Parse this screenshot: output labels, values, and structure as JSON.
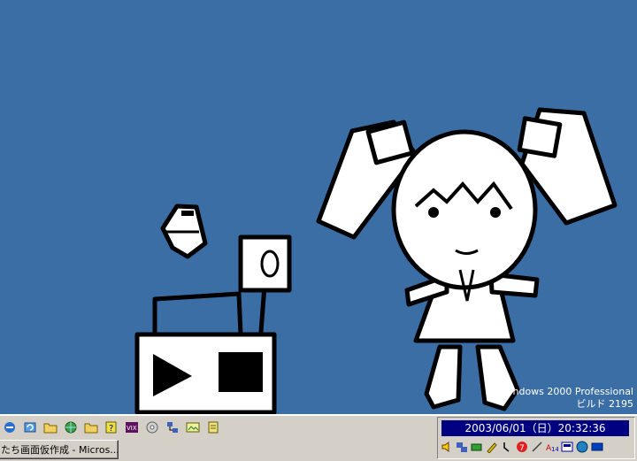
{
  "watermark": {
    "line1": "ndows 2000 Professional",
    "line2": "ビルド 2195"
  },
  "taskbar": {
    "task_button_label": "たち画面仮作成 - Micros...",
    "quick_launch": [
      "ie-icon",
      "refresh-icon",
      "folder-icon",
      "globe-icon",
      "folder-icon",
      "help-book-icon",
      "vix-icon",
      "cd-icon",
      "network-icon",
      "picture-icon",
      "notepad-icon"
    ],
    "clock": "2003/06/01（日）20:32:36",
    "tray_icons": [
      "speaker-icon",
      "network-icon",
      "battery-icon",
      "pen-icon",
      "power-icon",
      "antivirus-icon",
      "stylus-icon",
      "font-icon",
      "ime-icon",
      "globe-icon",
      "monitor-icon"
    ]
  },
  "colors": {
    "desktop": "#3a6ea5",
    "taskbar": "#d4d0c8",
    "clock_bg": "#000080"
  }
}
